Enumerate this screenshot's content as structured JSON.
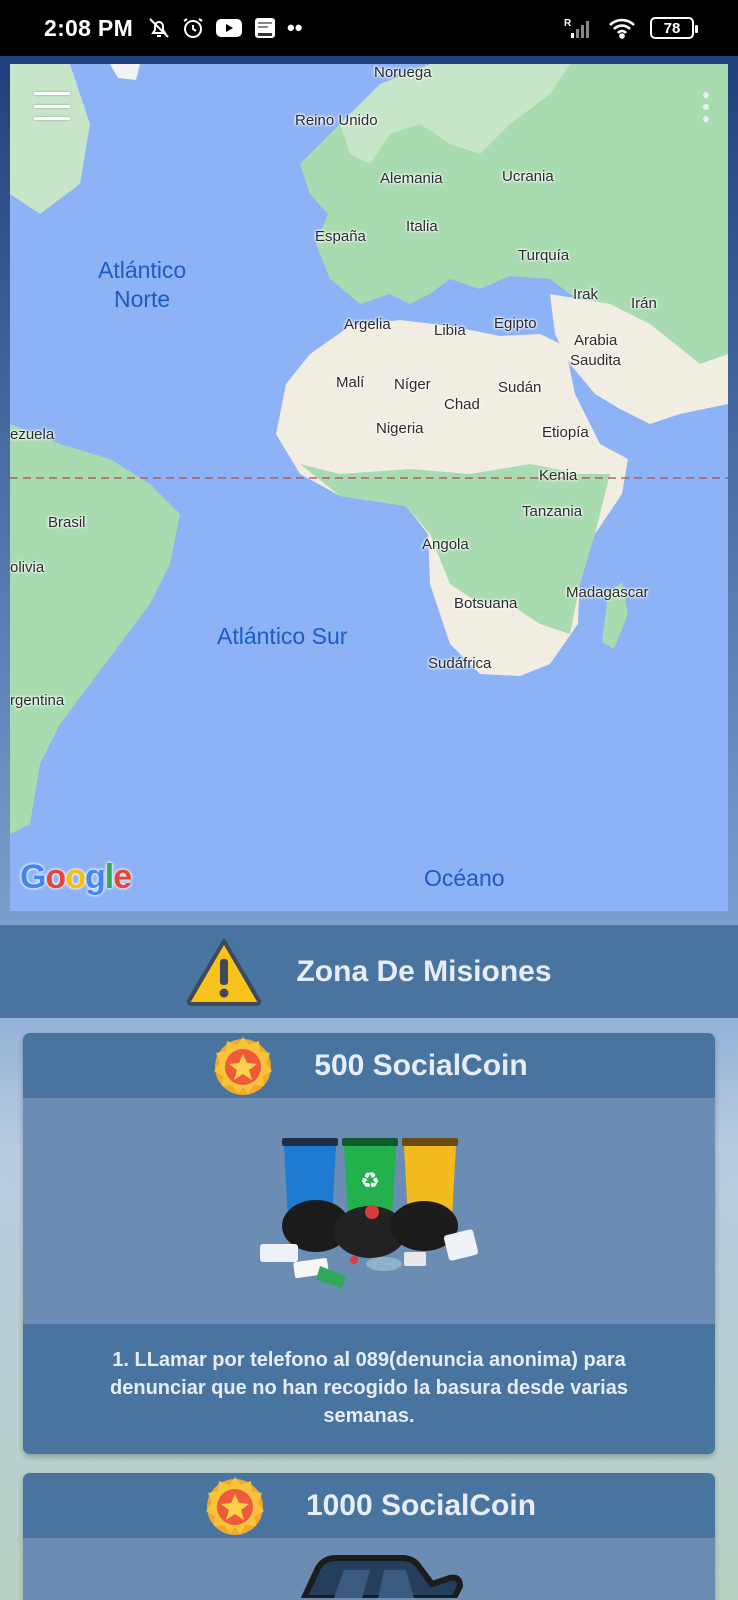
{
  "status_bar": {
    "time": "2:08 PM",
    "battery": "78",
    "signal_badge": "R",
    "more": "••"
  },
  "map": {
    "labels": {
      "noruega": "Noruega",
      "reino_unido": "Reino Unido",
      "alemania": "Alemania",
      "ucrania": "Ucrania",
      "espana": "España",
      "italia": "Italia",
      "turquia": "Turquía",
      "irak": "Irak",
      "iran": "Irán",
      "argelia": "Argelia",
      "libia": "Libia",
      "egipto": "Egipto",
      "arabia": "Arabia",
      "saudita": "Saudita",
      "mali": "Malí",
      "niger": "Níger",
      "sudan": "Sudán",
      "chad": "Chad",
      "nigeria": "Nigeria",
      "etiopia": "Etiopía",
      "venezuela": "ezuela",
      "kenia": "Kenia",
      "brasil": "Brasil",
      "tanzania": "Tanzania",
      "angola": "Angola",
      "bolivia": "olivia",
      "madagascar": "Madagascar",
      "botsuana": "Botsuana",
      "sudafrica": "Sudáfrica",
      "argentina": "rgentina"
    },
    "oceans": {
      "north_line1": "Atlántico",
      "north_line2": "Norte",
      "south": "Atlántico Sur",
      "oceano": "Océano"
    },
    "google_logo": "Google"
  },
  "zone": {
    "title": "Zona De Misiones",
    "icon": "warning-icon"
  },
  "missions": [
    {
      "reward": "500 SocialCoin",
      "image": "trash-bins-image",
      "description": "1. LLamar por telefono al 089(denuncia anonima) para denunciar que no han recogido la basura desde varias semanas."
    },
    {
      "reward": "1000 SocialCoin",
      "image": "car-image"
    }
  ],
  "colors": {
    "header_bg": "#4a74a0",
    "card_bg": "#6b8db3",
    "ocean": "#8db2f5",
    "land": "#f2ede2",
    "vegetation": "#a8dbb0"
  }
}
